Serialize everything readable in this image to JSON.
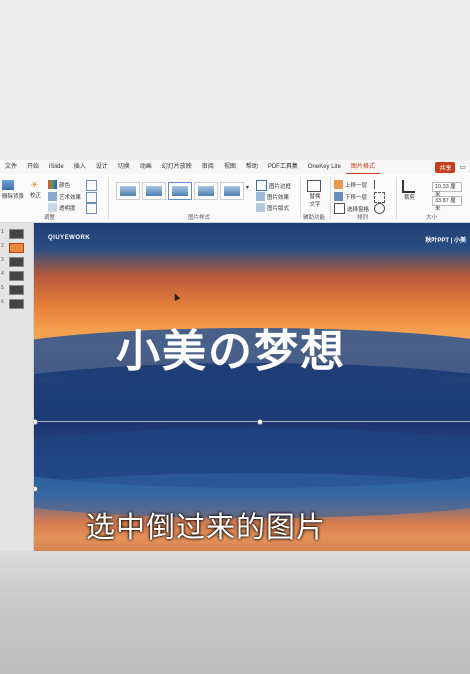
{
  "ribbon_tabs": [
    "文件",
    "开始",
    "iSlide",
    "插入",
    "设计",
    "切换",
    "动画",
    "幻灯片放映",
    "审阅",
    "视图",
    "帮助",
    "PDF工具集",
    "OneKey Lite",
    "图片格式"
  ],
  "share_label": "共享",
  "ribbon": {
    "remove_bg": "删除背景",
    "correct": "校正",
    "color": "颜色",
    "art_effects": "艺术效果",
    "transparency": "透明度",
    "group_adjust": "调整",
    "group_picture_styles": "图片样式",
    "border": "图片边框",
    "effects": "图片效果",
    "layout": "图片版式",
    "alt_text": "替换文字",
    "group_accessibility": "辅助功能",
    "bring_forward": "上移一层",
    "send_backward": "下移一层",
    "selection_pane": "选择窗格",
    "group_arrange": "排列",
    "crop": "裁剪",
    "height": "10.33 厘米",
    "width": "33.87 厘米",
    "group_size": "大小"
  },
  "slide": {
    "brand_left": "QIUYEWORK",
    "brand_right": "秋叶PPT | 小美",
    "title": "小美の梦想"
  },
  "caption": "选中倒过来的图片",
  "slide_numbers": [
    "1",
    "2",
    "3",
    "4",
    "5",
    "6"
  ]
}
